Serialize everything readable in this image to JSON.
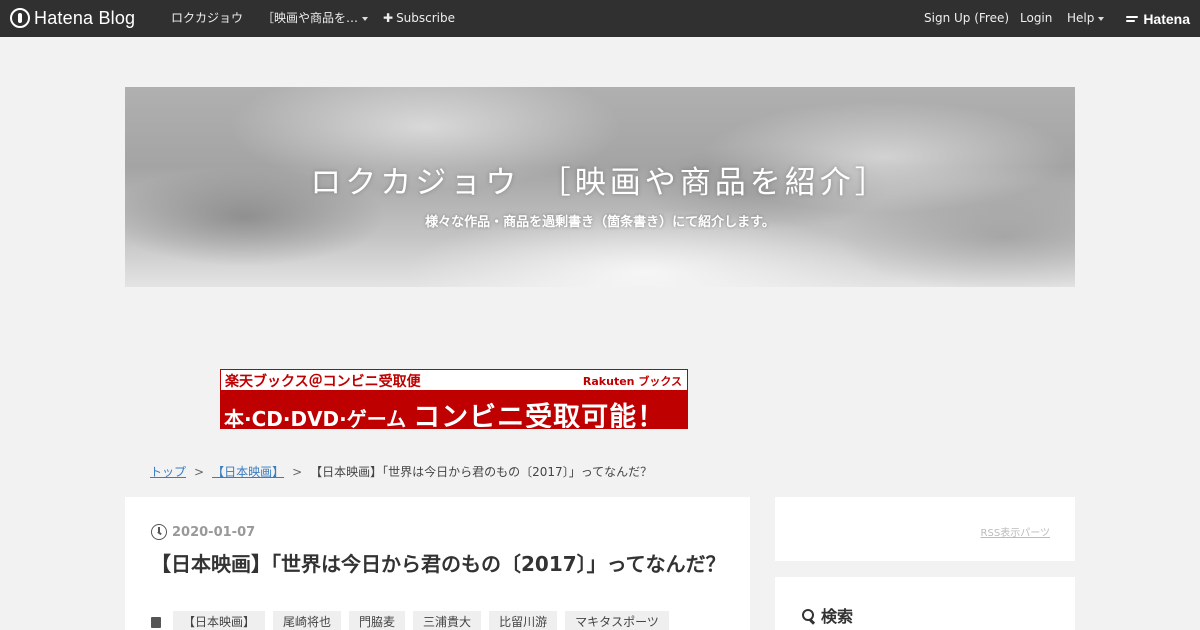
{
  "topbar": {
    "logo_text": "Hatena Blog",
    "blog_name": "ロクカジョウ",
    "blog_menu": "［映画や商品を…",
    "subscribe": "Subscribe",
    "signup": "Sign Up (Free)",
    "login": "Login",
    "help": "Help",
    "hatena": "Hatena"
  },
  "header": {
    "title": "ロクカジョウ　［映画や商品を紹介］",
    "description": "様々な作品・商品を過剰書き（箇条書き）にて紹介します。"
  },
  "banner": {
    "top_text": "楽天ブックス＠コンビニ受取便",
    "brand": "Rakuten ブックス",
    "bottom_small": "本·CD·DVD·ゲーム",
    "bottom_big": "コンビニ受取可能！"
  },
  "breadcrumb": {
    "top": "トップ",
    "category": "【日本映画】",
    "current": "【日本映画】「世界は今日から君のもの〔2017〕」ってなんだ？"
  },
  "article": {
    "date": "2020-01-07",
    "title": "【日本映画】「世界は今日から君のもの〔2017〕」ってなんだ？",
    "tags": [
      "【日本映画】",
      "尾崎将也",
      "門脇麦",
      "三浦貴大",
      "比留川游",
      "マキタスポーツ"
    ]
  },
  "sidebar": {
    "rss_link": "RSS表示パーツ",
    "search_title": "検索"
  }
}
